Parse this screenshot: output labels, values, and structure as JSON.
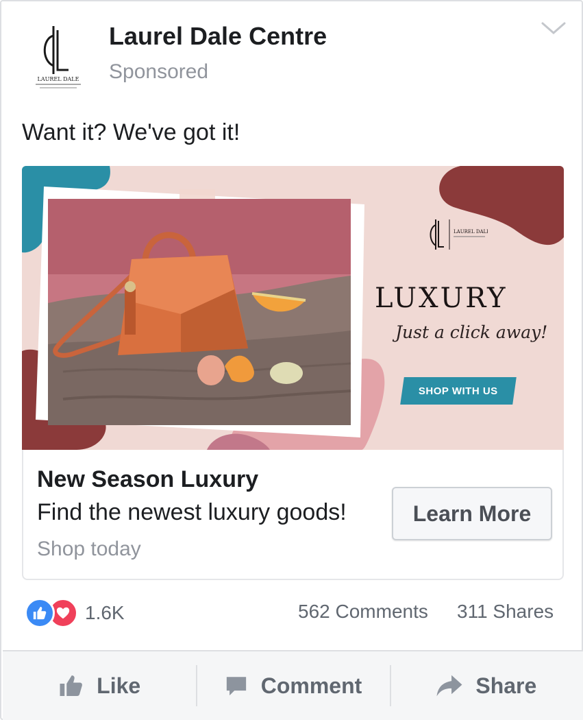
{
  "post": {
    "page_name": "Laurel Dale Centre",
    "sponsored_label": "Sponsored",
    "logo_text": "LAUREL DALE",
    "text": "Want it? We've got it!"
  },
  "ad_creative": {
    "headline": "LUXURY",
    "tagline": "Just a click away!",
    "cta": "SHOP WITH US",
    "brand_logo_text": "LAUREL DALE"
  },
  "link_preview": {
    "headline": "New Season Luxury",
    "description": "Find the newest luxury goods!",
    "subtext": "Shop today",
    "button_label": "Learn More"
  },
  "engagement": {
    "reaction_count": "1.6K",
    "comments": "562 Comments",
    "shares": "311 Shares",
    "reaction_icons": [
      "like-icon",
      "love-icon"
    ]
  },
  "actions": {
    "like": "Like",
    "comment": "Comment",
    "share": "Share"
  },
  "colors": {
    "like_blue": "#3b8af5",
    "love_red": "#f0405a",
    "teal_accent": "#2a8fa6",
    "maroon_accent": "#8b3a3a",
    "muted_text": "#90949c"
  }
}
